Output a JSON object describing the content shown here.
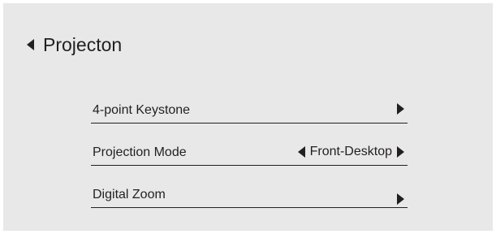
{
  "header": {
    "title": "Projecton",
    "back_icon": "triangle-left-icon"
  },
  "menu": {
    "items": [
      {
        "label": "4-point Keystone",
        "control": "submenu",
        "icon": "triangle-right-icon"
      },
      {
        "label": "Projection Mode",
        "control": "selector",
        "value": "Front-Desktop",
        "icons": [
          "triangle-left-icon",
          "triangle-right-icon"
        ]
      },
      {
        "label": "Digital Zoom",
        "control": "submenu",
        "icon": "triangle-right-icon"
      }
    ]
  },
  "colors": {
    "background": "#e8e8e9",
    "text": "#231f20",
    "divider": "#231f20"
  }
}
